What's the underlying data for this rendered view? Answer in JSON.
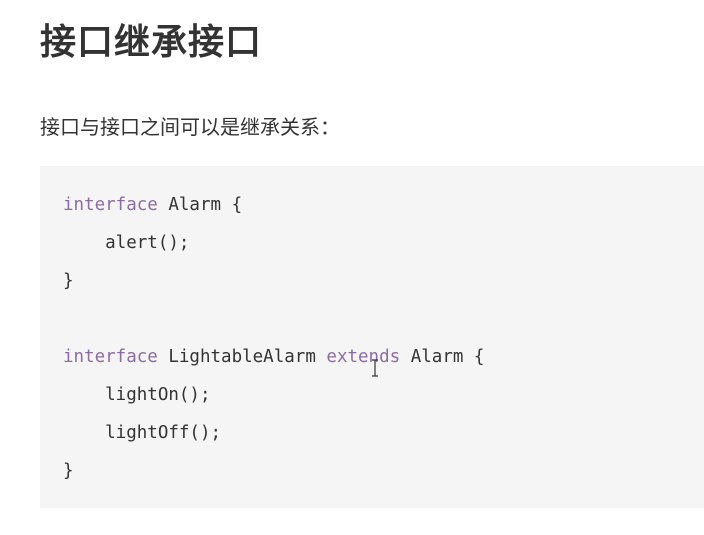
{
  "heading": "接口继承接口",
  "intro_text": "接口与接口之间可以是继承关系：",
  "code": {
    "line1": {
      "kw": "interface",
      "rest": " Alarm {"
    },
    "line2": {
      "text": "    alert();"
    },
    "line3": {
      "text": "}"
    },
    "line4": {
      "kw": "interface",
      "mid": " LightableAlarm ",
      "kw2": "extends",
      "rest": " Alarm {"
    },
    "line5": {
      "text": "    lightOn();"
    },
    "line6": {
      "text": "    lightOff();"
    },
    "line7": {
      "text": "}"
    }
  },
  "colors": {
    "keyword": "#8e6ba6",
    "code_background": "#f5f5f5",
    "text": "#333333"
  }
}
